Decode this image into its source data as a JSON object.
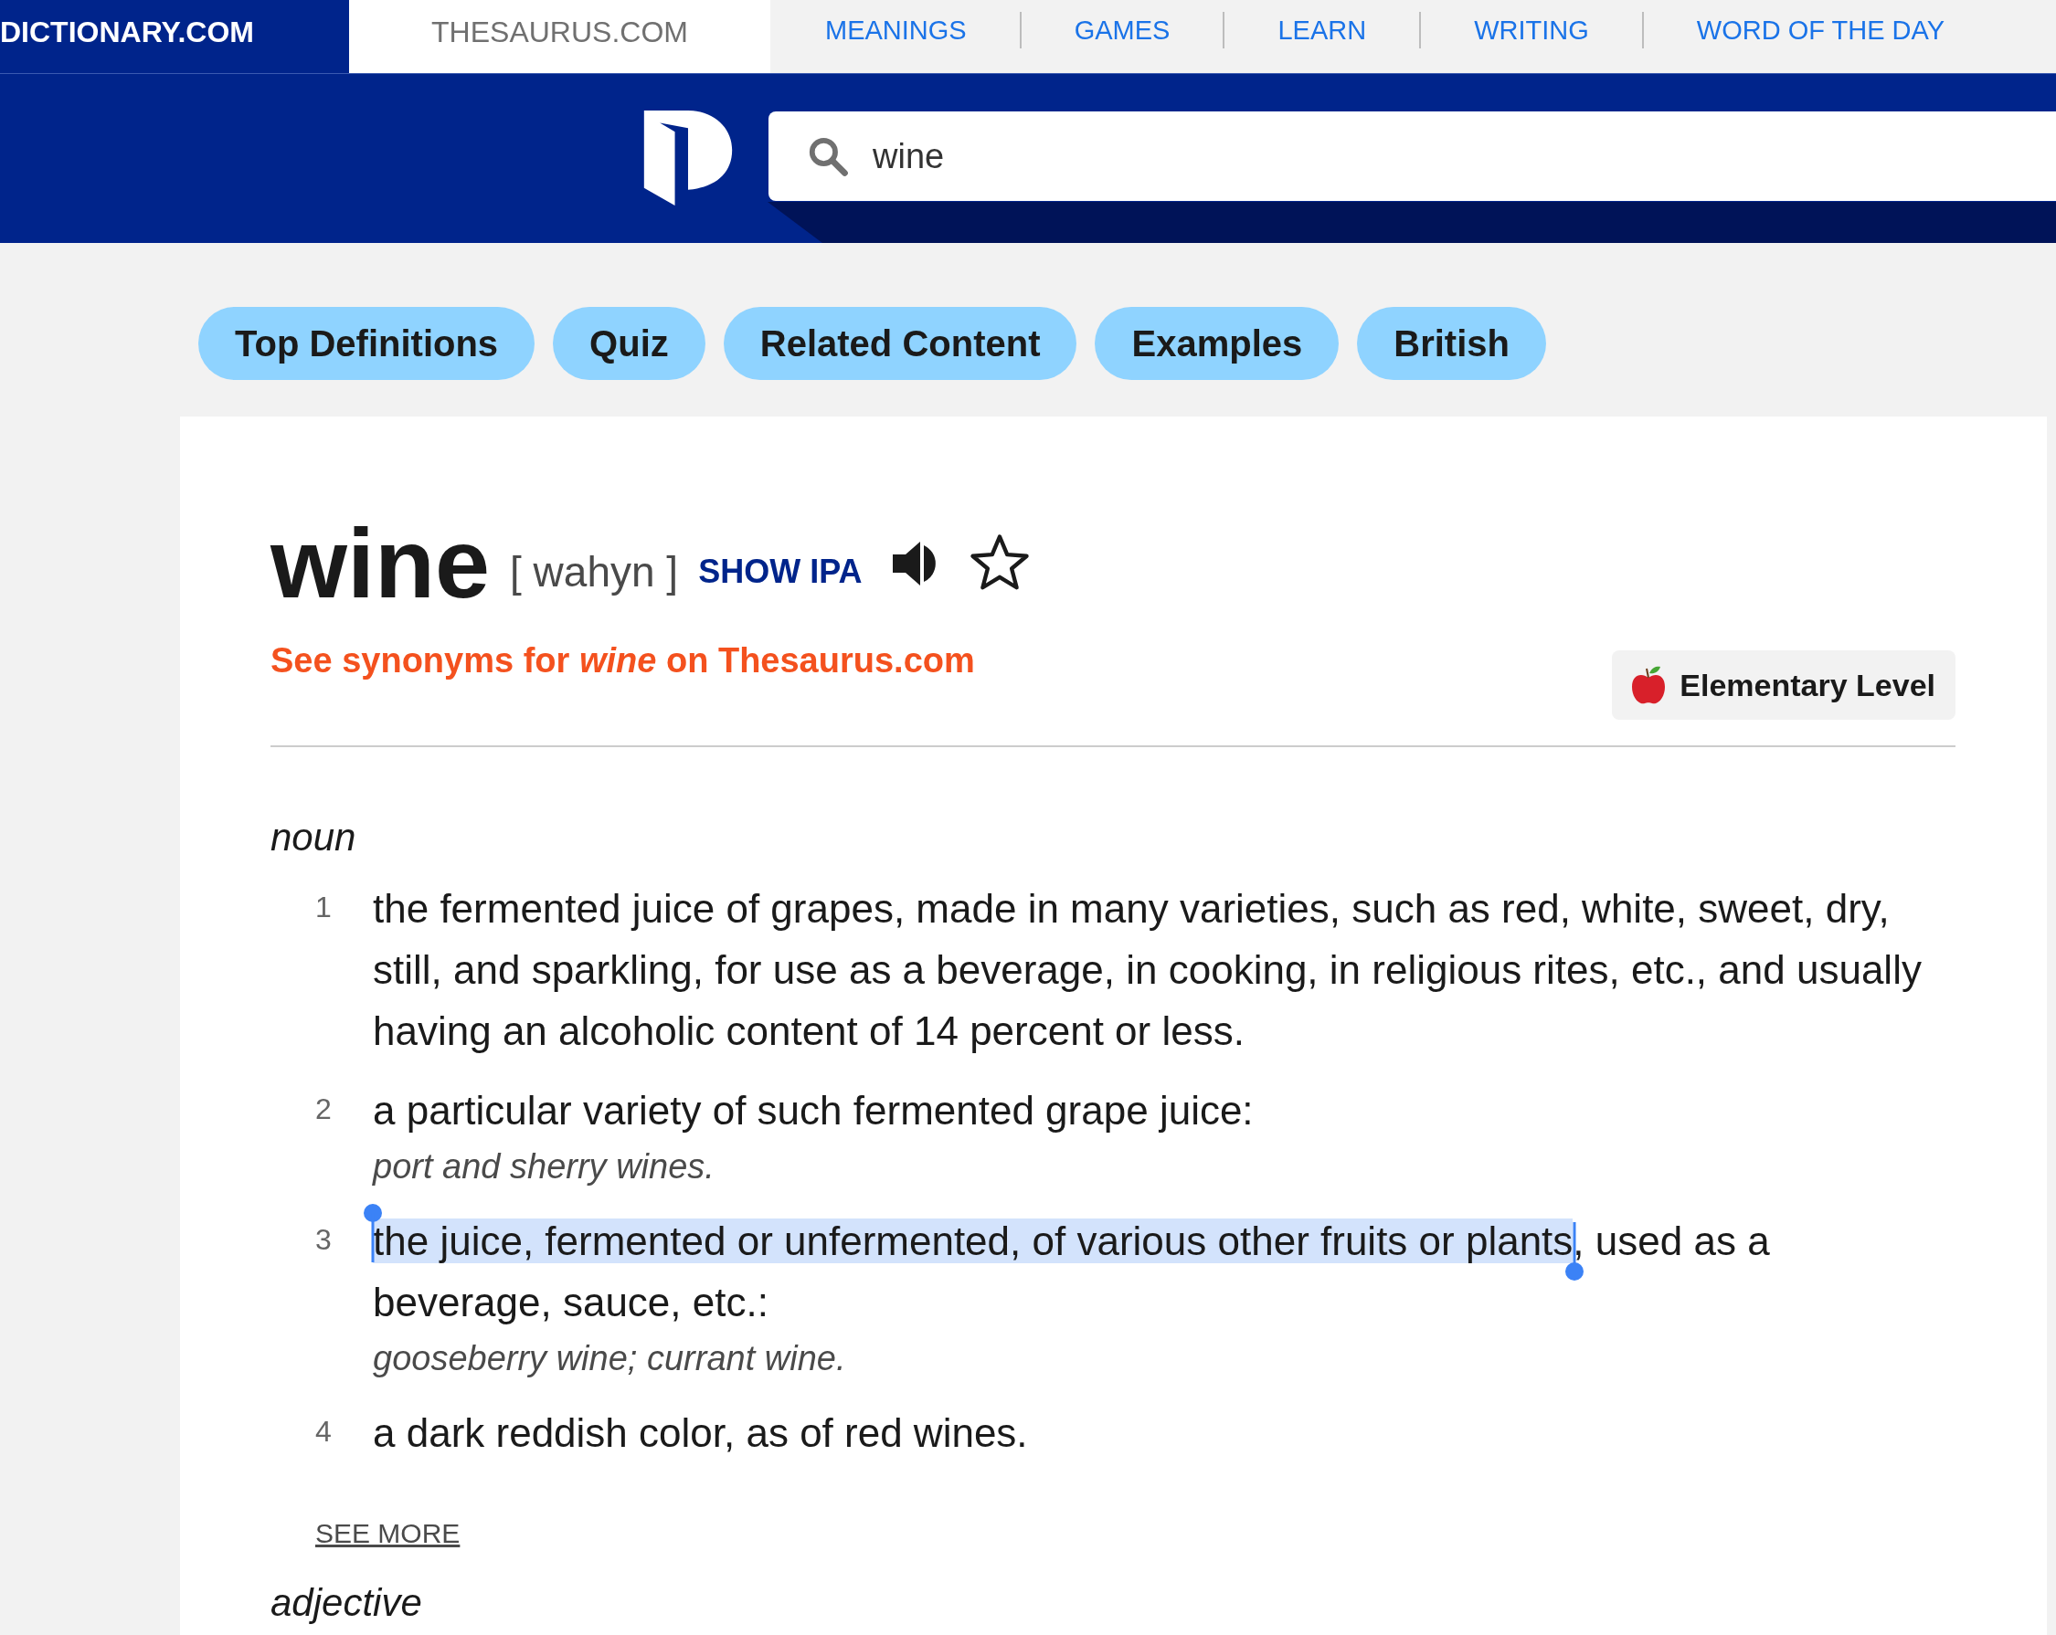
{
  "site_tabs": [
    {
      "label": "DICTIONARY.COM",
      "selected": true
    },
    {
      "label": "THESAURUS.COM",
      "selected": false
    }
  ],
  "nav_links": [
    "MEANINGS",
    "GAMES",
    "LEARN",
    "WRITING",
    "WORD OF THE DAY"
  ],
  "search": {
    "value": "wine"
  },
  "section_buttons": [
    "Top Definitions",
    "Quiz",
    "Related Content",
    "Examples",
    "British"
  ],
  "entry": {
    "headword": "wine",
    "pronunciation": "[ wahyn ]",
    "show_ipa": "SHOW IPA",
    "bookmarked": false,
    "synonyms_link": "See synonyms for *wine* on Thesaurus.com",
    "level_badge": "Elementary Level"
  },
  "senses": [
    {
      "part_of_speech": "noun",
      "definitions": [
        {
          "number": "1",
          "text": "the fermented juice of grapes, made in many varieties, such as red, white, sweet, dry, still, and sparkling, for use as a beverage, in cooking, in religious rites, etc., and usually having an alcoholic content of 14 percent or less."
        },
        {
          "number": "2",
          "text": "a particular variety of such fermented grape juice:",
          "example": "port and sherry wines."
        },
        {
          "number": "3",
          "selected_text": "the juice, fermented or unfermented, of various other fruits or plants",
          "text": ", used as a beverage, sauce, etc.:",
          "example": "gooseberry wine; currant wine."
        },
        {
          "number": "4",
          "text": "a dark reddish color, as of red wines."
        }
      ],
      "see_more": "SEE MORE"
    },
    {
      "part_of_speech": "adjective"
    }
  ]
}
